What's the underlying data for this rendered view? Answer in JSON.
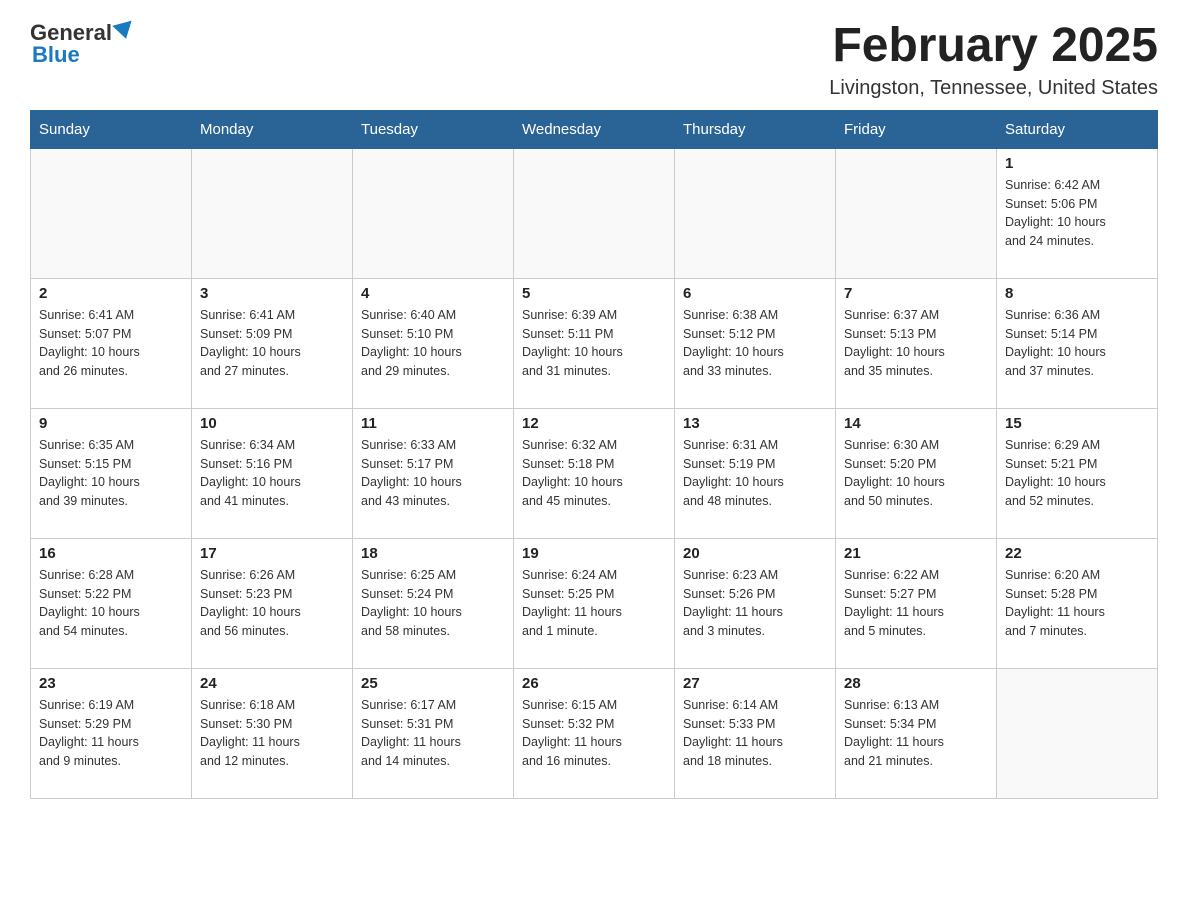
{
  "logo": {
    "general": "General",
    "blue": "Blue"
  },
  "header": {
    "title": "February 2025",
    "location": "Livingston, Tennessee, United States"
  },
  "days_of_week": [
    "Sunday",
    "Monday",
    "Tuesday",
    "Wednesday",
    "Thursday",
    "Friday",
    "Saturday"
  ],
  "weeks": [
    [
      {
        "day": "",
        "info": ""
      },
      {
        "day": "",
        "info": ""
      },
      {
        "day": "",
        "info": ""
      },
      {
        "day": "",
        "info": ""
      },
      {
        "day": "",
        "info": ""
      },
      {
        "day": "",
        "info": ""
      },
      {
        "day": "1",
        "info": "Sunrise: 6:42 AM\nSunset: 5:06 PM\nDaylight: 10 hours\nand 24 minutes."
      }
    ],
    [
      {
        "day": "2",
        "info": "Sunrise: 6:41 AM\nSunset: 5:07 PM\nDaylight: 10 hours\nand 26 minutes."
      },
      {
        "day": "3",
        "info": "Sunrise: 6:41 AM\nSunset: 5:09 PM\nDaylight: 10 hours\nand 27 minutes."
      },
      {
        "day": "4",
        "info": "Sunrise: 6:40 AM\nSunset: 5:10 PM\nDaylight: 10 hours\nand 29 minutes."
      },
      {
        "day": "5",
        "info": "Sunrise: 6:39 AM\nSunset: 5:11 PM\nDaylight: 10 hours\nand 31 minutes."
      },
      {
        "day": "6",
        "info": "Sunrise: 6:38 AM\nSunset: 5:12 PM\nDaylight: 10 hours\nand 33 minutes."
      },
      {
        "day": "7",
        "info": "Sunrise: 6:37 AM\nSunset: 5:13 PM\nDaylight: 10 hours\nand 35 minutes."
      },
      {
        "day": "8",
        "info": "Sunrise: 6:36 AM\nSunset: 5:14 PM\nDaylight: 10 hours\nand 37 minutes."
      }
    ],
    [
      {
        "day": "9",
        "info": "Sunrise: 6:35 AM\nSunset: 5:15 PM\nDaylight: 10 hours\nand 39 minutes."
      },
      {
        "day": "10",
        "info": "Sunrise: 6:34 AM\nSunset: 5:16 PM\nDaylight: 10 hours\nand 41 minutes."
      },
      {
        "day": "11",
        "info": "Sunrise: 6:33 AM\nSunset: 5:17 PM\nDaylight: 10 hours\nand 43 minutes."
      },
      {
        "day": "12",
        "info": "Sunrise: 6:32 AM\nSunset: 5:18 PM\nDaylight: 10 hours\nand 45 minutes."
      },
      {
        "day": "13",
        "info": "Sunrise: 6:31 AM\nSunset: 5:19 PM\nDaylight: 10 hours\nand 48 minutes."
      },
      {
        "day": "14",
        "info": "Sunrise: 6:30 AM\nSunset: 5:20 PM\nDaylight: 10 hours\nand 50 minutes."
      },
      {
        "day": "15",
        "info": "Sunrise: 6:29 AM\nSunset: 5:21 PM\nDaylight: 10 hours\nand 52 minutes."
      }
    ],
    [
      {
        "day": "16",
        "info": "Sunrise: 6:28 AM\nSunset: 5:22 PM\nDaylight: 10 hours\nand 54 minutes."
      },
      {
        "day": "17",
        "info": "Sunrise: 6:26 AM\nSunset: 5:23 PM\nDaylight: 10 hours\nand 56 minutes."
      },
      {
        "day": "18",
        "info": "Sunrise: 6:25 AM\nSunset: 5:24 PM\nDaylight: 10 hours\nand 58 minutes."
      },
      {
        "day": "19",
        "info": "Sunrise: 6:24 AM\nSunset: 5:25 PM\nDaylight: 11 hours\nand 1 minute."
      },
      {
        "day": "20",
        "info": "Sunrise: 6:23 AM\nSunset: 5:26 PM\nDaylight: 11 hours\nand 3 minutes."
      },
      {
        "day": "21",
        "info": "Sunrise: 6:22 AM\nSunset: 5:27 PM\nDaylight: 11 hours\nand 5 minutes."
      },
      {
        "day": "22",
        "info": "Sunrise: 6:20 AM\nSunset: 5:28 PM\nDaylight: 11 hours\nand 7 minutes."
      }
    ],
    [
      {
        "day": "23",
        "info": "Sunrise: 6:19 AM\nSunset: 5:29 PM\nDaylight: 11 hours\nand 9 minutes."
      },
      {
        "day": "24",
        "info": "Sunrise: 6:18 AM\nSunset: 5:30 PM\nDaylight: 11 hours\nand 12 minutes."
      },
      {
        "day": "25",
        "info": "Sunrise: 6:17 AM\nSunset: 5:31 PM\nDaylight: 11 hours\nand 14 minutes."
      },
      {
        "day": "26",
        "info": "Sunrise: 6:15 AM\nSunset: 5:32 PM\nDaylight: 11 hours\nand 16 minutes."
      },
      {
        "day": "27",
        "info": "Sunrise: 6:14 AM\nSunset: 5:33 PM\nDaylight: 11 hours\nand 18 minutes."
      },
      {
        "day": "28",
        "info": "Sunrise: 6:13 AM\nSunset: 5:34 PM\nDaylight: 11 hours\nand 21 minutes."
      },
      {
        "day": "",
        "info": ""
      }
    ]
  ]
}
